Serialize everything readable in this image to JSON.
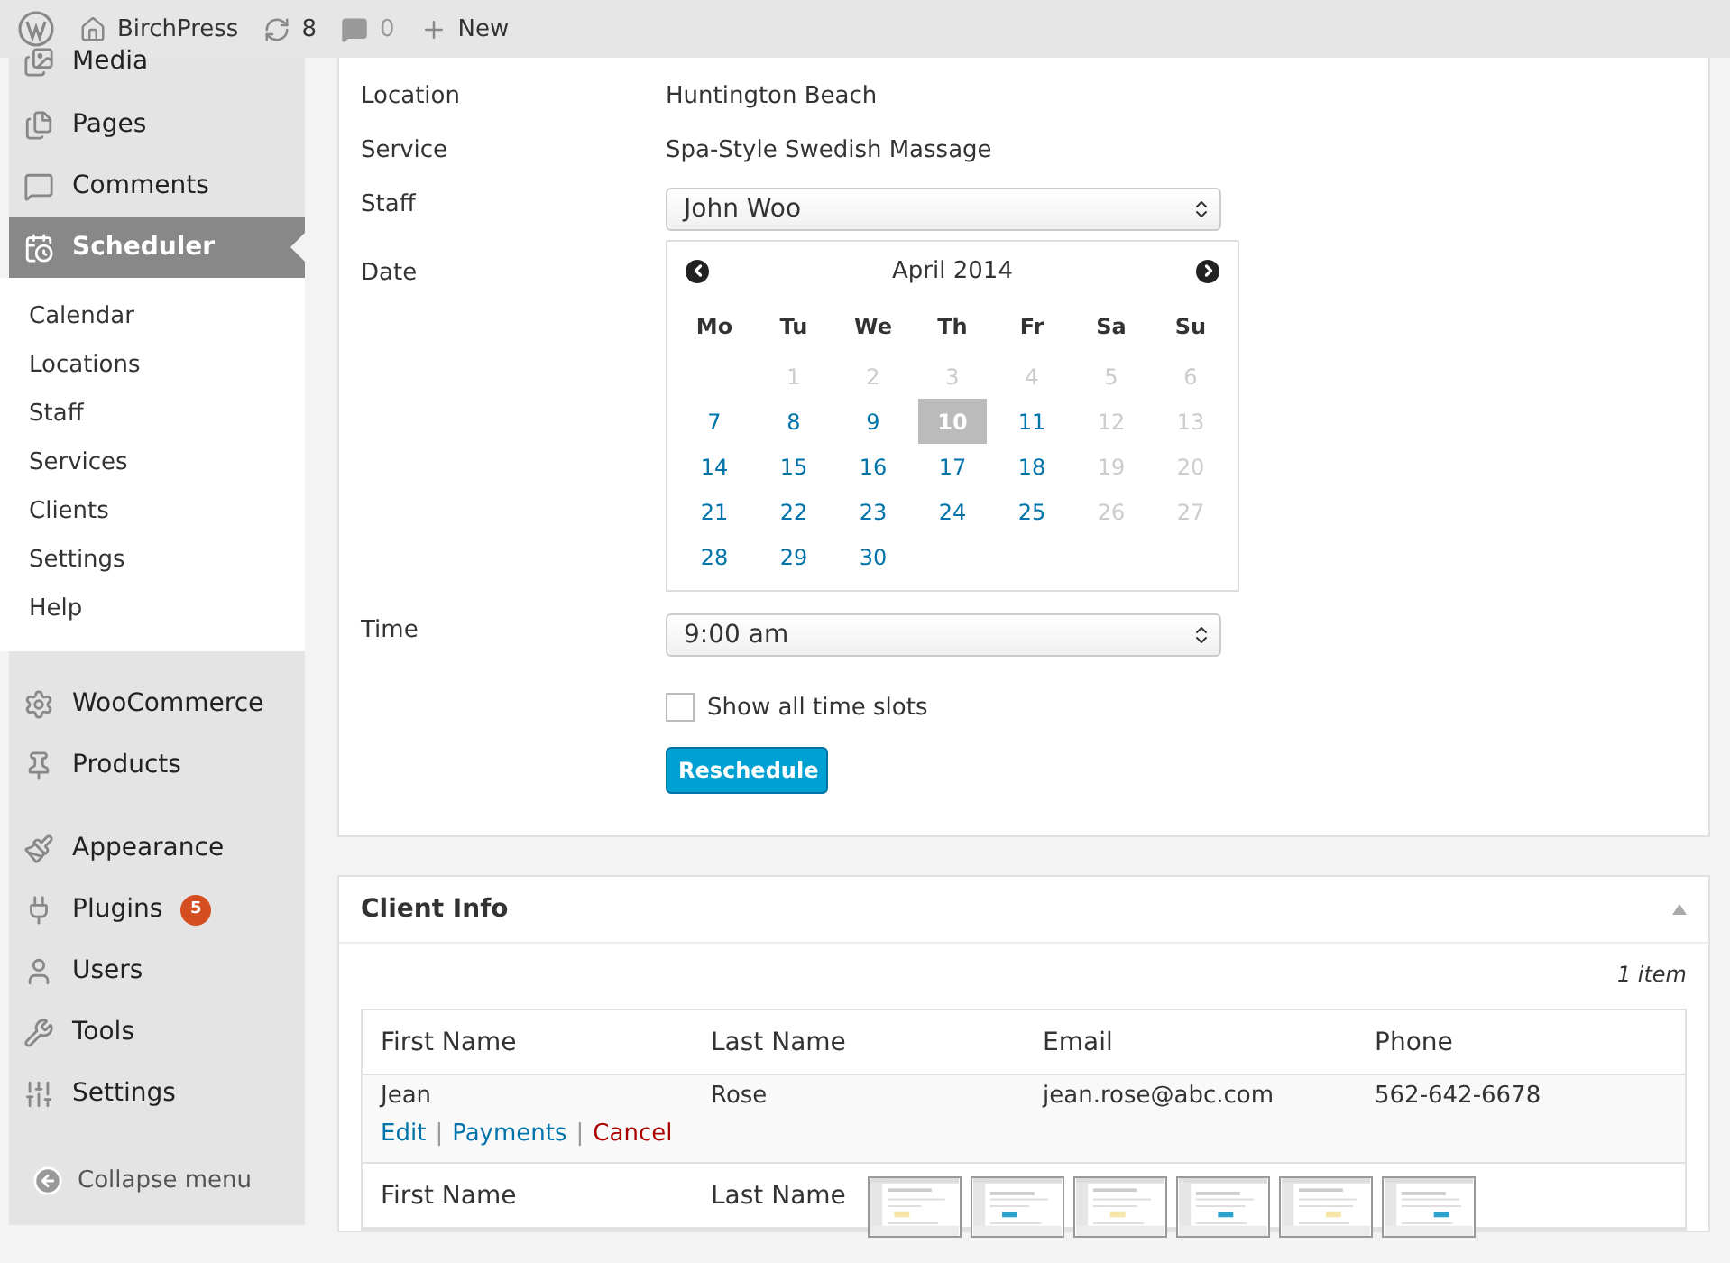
{
  "admin_bar": {
    "site": "BirchPress",
    "updates": "8",
    "comments": "0",
    "new": "New"
  },
  "sidebar": {
    "groups": [
      {
        "items": [
          {
            "label": "Media",
            "selected": false
          },
          {
            "label": "Pages",
            "selected": false
          },
          {
            "label": "Comments",
            "selected": false
          },
          {
            "label": "Scheduler",
            "selected": true,
            "children": [
              "Calendar",
              "Locations",
              "Staff",
              "Services",
              "Clients",
              "Settings",
              "Help"
            ]
          }
        ]
      },
      {
        "items": [
          {
            "label": "WooCommerce",
            "selected": false
          },
          {
            "label": "Products",
            "selected": false
          }
        ]
      },
      {
        "items": [
          {
            "label": "Appearance",
            "selected": false
          },
          {
            "label": "Plugins",
            "selected": false,
            "badge": "5"
          },
          {
            "label": "Users",
            "selected": false
          },
          {
            "label": "Tools",
            "selected": false
          },
          {
            "label": "Settings",
            "selected": false
          }
        ]
      }
    ],
    "collapse": "Collapse menu"
  },
  "form": {
    "location": {
      "label": "Location",
      "value": "Huntington Beach"
    },
    "service": {
      "label": "Service",
      "value": "Spa-Style Swedish Massage"
    },
    "staff": {
      "label": "Staff",
      "value": "John Woo"
    },
    "date": {
      "label": "Date",
      "month": "April 2014",
      "weekdays": [
        "Mo",
        "Tu",
        "We",
        "Th",
        "Fr",
        "Sa",
        "Su"
      ],
      "weeks": [
        [
          {
            "text": "1",
            "disabled": true,
            "selected": false
          },
          {
            "text": "2",
            "disabled": true,
            "selected": false
          },
          {
            "text": "3",
            "disabled": true,
            "selected": false
          },
          {
            "text": "4",
            "disabled": true,
            "selected": false
          },
          {
            "text": "5",
            "disabled": true,
            "selected": false
          },
          {
            "text": "6",
            "disabled": true,
            "selected": false
          }
        ],
        [
          {
            "text": "7",
            "disabled": false,
            "selected": false
          },
          {
            "text": "8",
            "disabled": false,
            "selected": false
          },
          {
            "text": "9",
            "disabled": false,
            "selected": false
          },
          {
            "text": "10",
            "disabled": false,
            "selected": true
          },
          {
            "text": "11",
            "disabled": false,
            "selected": false
          },
          {
            "text": "12",
            "disabled": true,
            "selected": false
          },
          {
            "text": "13",
            "disabled": true,
            "selected": false
          }
        ],
        [
          {
            "text": "14",
            "disabled": false,
            "selected": false
          },
          {
            "text": "15",
            "disabled": false,
            "selected": false
          },
          {
            "text": "16",
            "disabled": false,
            "selected": false
          },
          {
            "text": "17",
            "disabled": false,
            "selected": false
          },
          {
            "text": "18",
            "disabled": false,
            "selected": false
          },
          {
            "text": "19",
            "disabled": true,
            "selected": false
          },
          {
            "text": "20",
            "disabled": true,
            "selected": false
          }
        ],
        [
          {
            "text": "21",
            "disabled": false,
            "selected": false
          },
          {
            "text": "22",
            "disabled": false,
            "selected": false
          },
          {
            "text": "23",
            "disabled": false,
            "selected": false
          },
          {
            "text": "24",
            "disabled": false,
            "selected": false
          },
          {
            "text": "25",
            "disabled": false,
            "selected": false
          },
          {
            "text": "26",
            "disabled": true,
            "selected": false
          },
          {
            "text": "27",
            "disabled": true,
            "selected": false
          }
        ],
        [
          {
            "text": "28",
            "disabled": false,
            "selected": false
          },
          {
            "text": "29",
            "disabled": false,
            "selected": false
          },
          {
            "text": "30",
            "disabled": false,
            "selected": false
          }
        ]
      ]
    },
    "time": {
      "label": "Time",
      "value": "9:00 am"
    },
    "show_all": {
      "label": "Show all time slots",
      "checked": false
    },
    "button": "Reschedule"
  },
  "client_info": {
    "title": "Client Info",
    "count": "1 item",
    "columns": [
      "First Name",
      "Last Name",
      "Email",
      "Phone"
    ],
    "rows": [
      {
        "cells": [
          "Jean",
          "Rose",
          "jean.rose@abc.com",
          "562-642-6678"
        ],
        "actions": [
          "Edit",
          "Payments",
          "Cancel"
        ],
        "separators": [
          "|",
          "|"
        ]
      }
    ],
    "footer": [
      "First Name",
      "Last Name"
    ]
  }
}
